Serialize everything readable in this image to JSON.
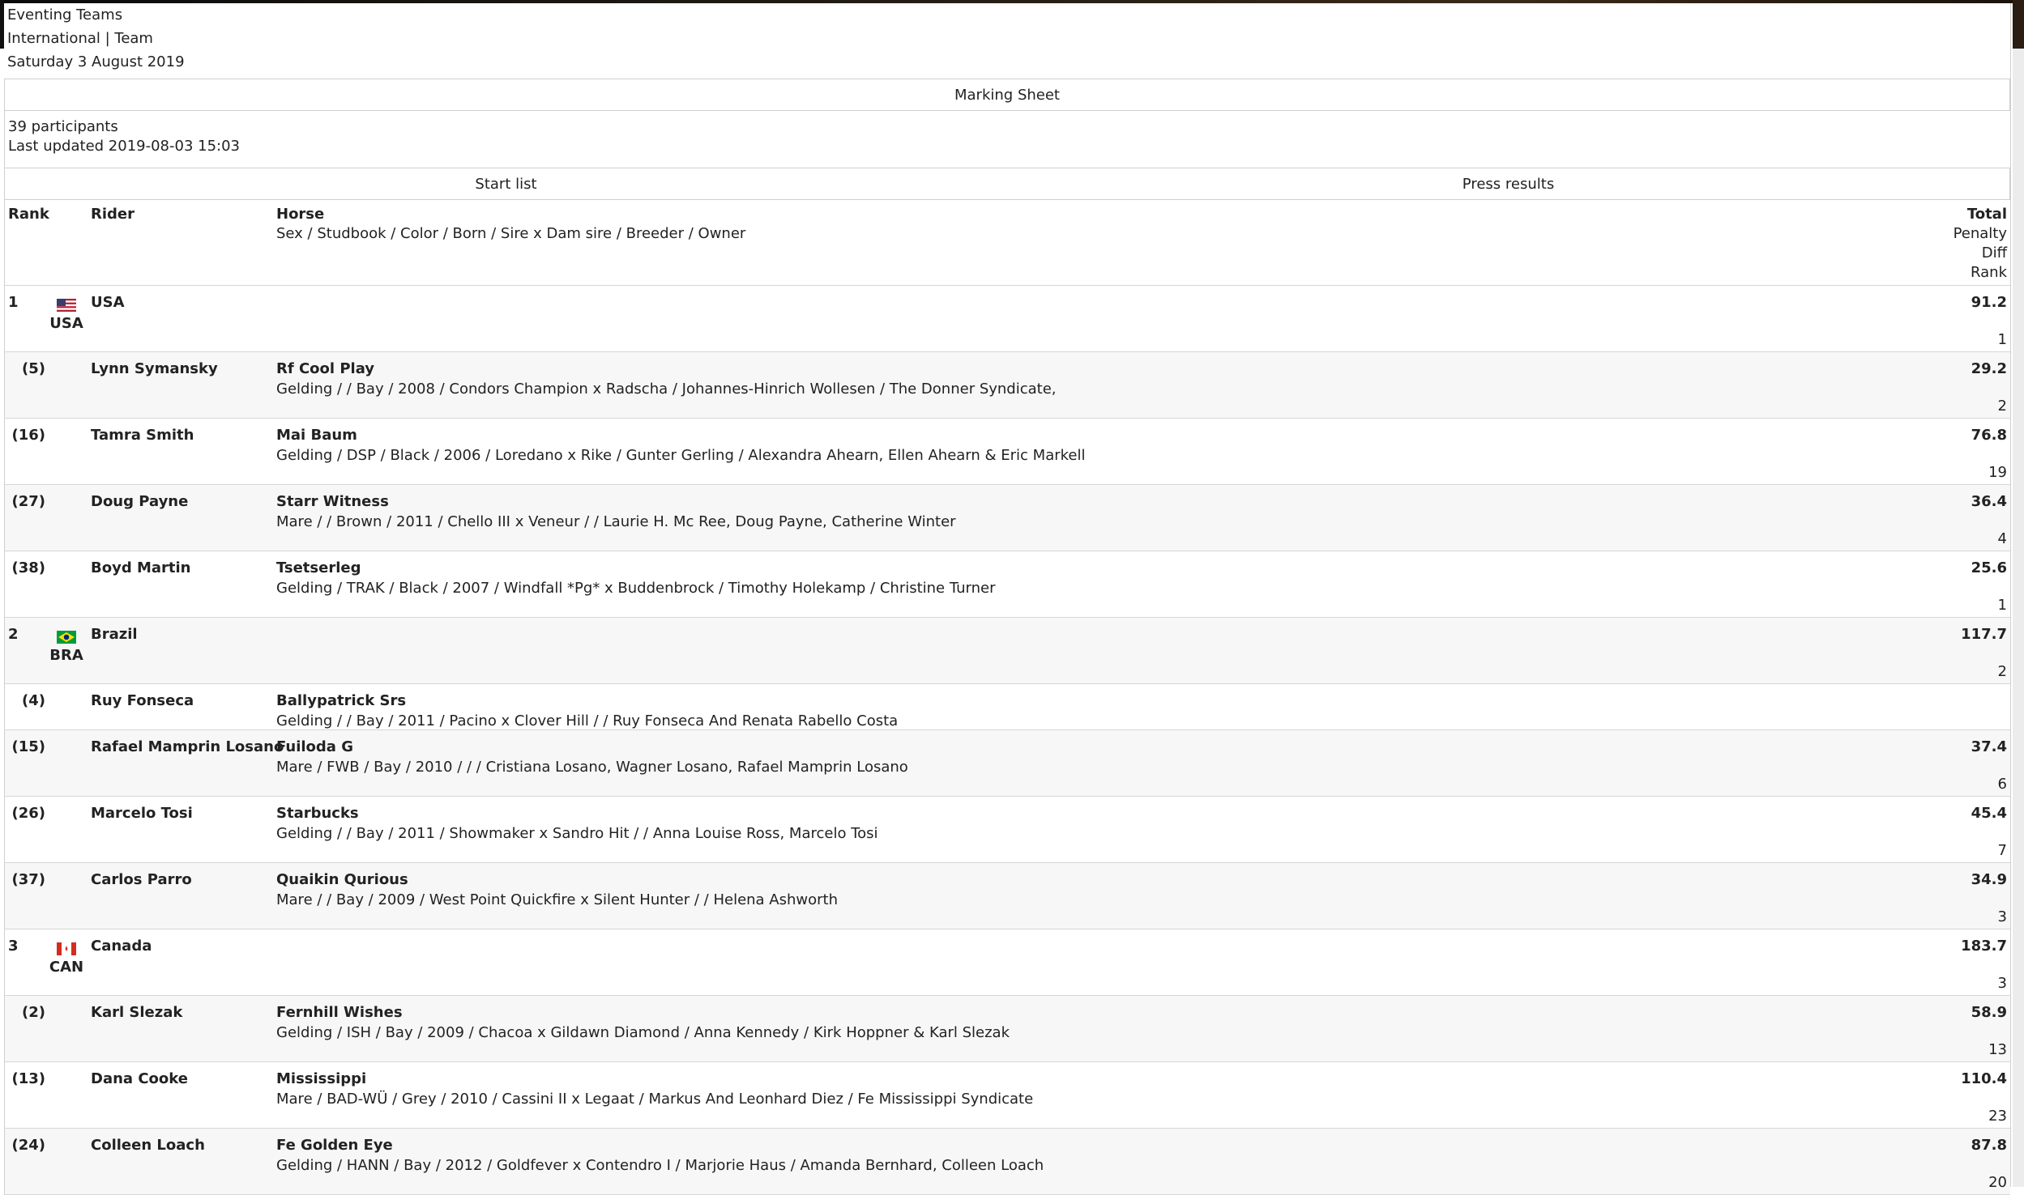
{
  "event": {
    "title": "Eventing Teams",
    "subtitle": "International | Team",
    "date": "Saturday 3 August 2019"
  },
  "marking_sheet_label": "Marking Sheet",
  "info": {
    "participants": "39 participants",
    "last_updated": "Last updated 2019-08-03 15:03"
  },
  "tabs": [
    {
      "label": "Start list"
    },
    {
      "label": "Press results"
    }
  ],
  "columns": {
    "rank": "Rank",
    "rider": "Rider",
    "horse": "Horse",
    "horse_sub": "Sex / Studbook / Color / Born / Sire x Dam sire / Breeder / Owner",
    "total": "Total",
    "penalty": "Penalty",
    "diff": "Diff",
    "rank2": "Rank"
  },
  "rows": [
    {
      "type": "team",
      "rank": "1",
      "name": "USA",
      "code": "USA",
      "flag": "us",
      "total": "91.2",
      "trank": "1"
    },
    {
      "type": "rider",
      "pos": "(5)",
      "rider": "Lynn Symansky",
      "horse": "Rf Cool Play",
      "details": "Gelding / / Bay / 2008 / Condors Champion x Radscha / Johannes-Hinrich Wollesen / The Donner Syndicate,",
      "total": "29.2",
      "trank": "2"
    },
    {
      "type": "rider",
      "pos": "(16)",
      "rider": "Tamra Smith",
      "horse": "Mai Baum",
      "details": "Gelding / DSP / Black / 2006 / Loredano x Rike / Gunter Gerling / Alexandra Ahearn, Ellen Ahearn & Eric Markell",
      "total": "76.8",
      "trank": "19"
    },
    {
      "type": "rider",
      "pos": "(27)",
      "rider": "Doug Payne",
      "horse": "Starr Witness",
      "details": "Mare / / Brown / 2011 / Chello III x Veneur / / Laurie H. Mc Ree, Doug Payne, Catherine Winter",
      "total": "36.4",
      "trank": "4"
    },
    {
      "type": "rider",
      "pos": "(38)",
      "rider": "Boyd Martin",
      "horse": "Tsetserleg",
      "details": "Gelding / TRAK / Black / 2007 / Windfall *Pg* x Buddenbrock / Timothy Holekamp / Christine Turner",
      "total": "25.6",
      "trank": "1"
    },
    {
      "type": "team",
      "rank": "2",
      "name": "Brazil",
      "code": "BRA",
      "flag": "br",
      "total": "117.7",
      "trank": "2"
    },
    {
      "type": "rider",
      "short": true,
      "pos": "(4)",
      "rider": "Ruy Fonseca",
      "horse": "Ballypatrick Srs",
      "details": "Gelding / / Bay / 2011 / Pacino x Clover Hill / / Ruy Fonseca And Renata Rabello Costa",
      "total": "",
      "trank": ""
    },
    {
      "type": "rider",
      "pos": "(15)",
      "rider": "Rafael Mamprin Losano",
      "horse": "Fuiloda G",
      "details": "Mare / FWB / Bay / 2010 / / / Cristiana Losano, Wagner Losano, Rafael Mamprin Losano",
      "total": "37.4",
      "trank": "6"
    },
    {
      "type": "rider",
      "pos": "(26)",
      "rider": "Marcelo Tosi",
      "horse": "Starbucks",
      "details": "Gelding / / Bay / 2011 / Showmaker x Sandro Hit / / Anna Louise Ross, Marcelo Tosi",
      "total": "45.4",
      "trank": "7"
    },
    {
      "type": "rider",
      "pos": "(37)",
      "rider": "Carlos Parro",
      "horse": "Quaikin Qurious",
      "details": "Mare / / Bay / 2009 / West Point Quickfire x Silent Hunter / / Helena Ashworth",
      "total": "34.9",
      "trank": "3"
    },
    {
      "type": "team",
      "rank": "3",
      "name": "Canada",
      "code": "CAN",
      "flag": "ca",
      "total": "183.7",
      "trank": "3"
    },
    {
      "type": "rider",
      "pos": "(2)",
      "rider": "Karl Slezak",
      "horse": "Fernhill Wishes",
      "details": "Gelding / ISH / Bay / 2009 / Chacoa x Gildawn Diamond / Anna Kennedy / Kirk Hoppner & Karl Slezak",
      "total": "58.9",
      "trank": "13"
    },
    {
      "type": "rider",
      "pos": "(13)",
      "rider": "Dana Cooke",
      "horse": "Mississippi",
      "details": "Mare / BAD-WÜ / Grey / 2010 / Cassini II x Legaat / Markus And Leonhard Diez / Fe Mississippi Syndicate",
      "total": "110.4",
      "trank": "23"
    },
    {
      "type": "rider",
      "pos": "(24)",
      "rider": "Colleen Loach",
      "horse": "Fe Golden Eye",
      "details": "Gelding / HANN / Bay / 2012 / Goldfever x Contendro I / Marjorie Haus / Amanda Bernhard, Colleen Loach",
      "total": "87.8",
      "trank": "20"
    }
  ]
}
